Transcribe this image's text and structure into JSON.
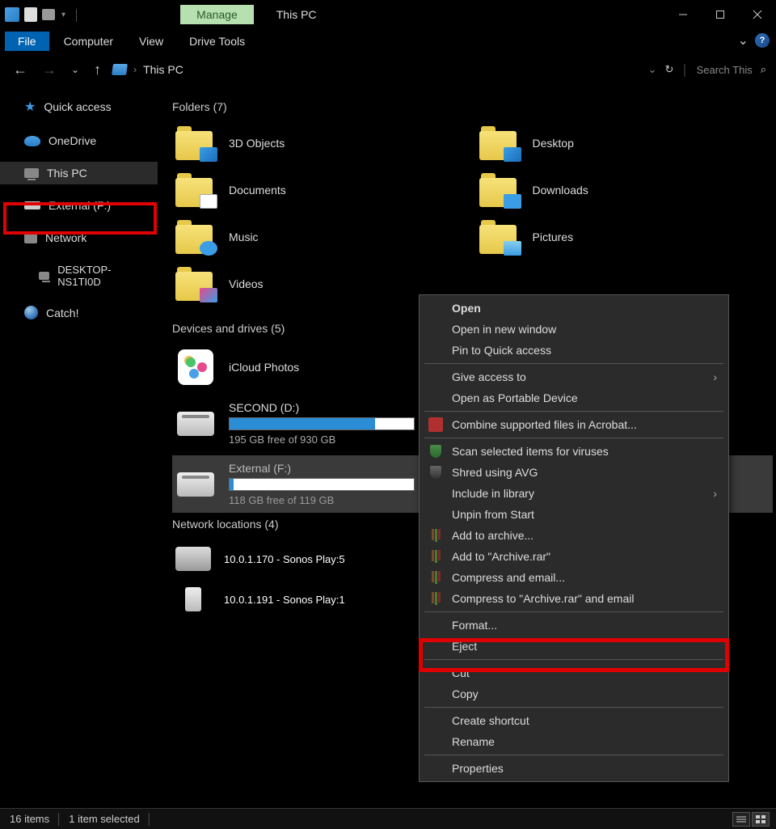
{
  "titlebar": {
    "manage_label": "Manage",
    "title": "This PC"
  },
  "ribbon": {
    "file": "File",
    "tabs": [
      "Computer",
      "View",
      "Drive Tools"
    ]
  },
  "addressbar": {
    "location": "This PC",
    "search_placeholder": "Search This"
  },
  "sidebar": {
    "quick_access": "Quick access",
    "onedrive": "OneDrive",
    "this_pc": "This PC",
    "external": "External (F:)",
    "network": "Network",
    "desktop_node": "DESKTOP-NS1TI0D",
    "catch": "Catch!"
  },
  "sections": {
    "folders_header": "Folders (7)",
    "devices_header": "Devices and drives (5)",
    "network_header": "Network locations (4)"
  },
  "folders": {
    "f0": "3D Objects",
    "f1": "Desktop",
    "f2": "Documents",
    "f3": "Downloads",
    "f4": "Music",
    "f5": "Pictures",
    "f6": "Videos"
  },
  "devices": {
    "icloud": "iCloud Photos",
    "second_name": "SECOND (D:)",
    "second_free": "195 GB free of 930 GB",
    "second_pct": 79,
    "external_name": "External (F:)",
    "external_free": "118 GB free of 119 GB",
    "external_pct": 2
  },
  "netloc": {
    "n0": "10.0.1.170 - Sonos Play:5",
    "n1": "10.0.1.191 - Sonos Play:1"
  },
  "context_menu": {
    "open": "Open",
    "open_new": "Open in new window",
    "pin_qa": "Pin to Quick access",
    "give_access": "Give access to",
    "open_portable": "Open as Portable Device",
    "combine_pdf": "Combine supported files in Acrobat...",
    "scan_virus": "Scan selected items for viruses",
    "shred": "Shred using AVG",
    "include_lib": "Include in library",
    "unpin_start": "Unpin from Start",
    "add_archive": "Add to archive...",
    "add_archive_rar": "Add to \"Archive.rar\"",
    "compress_email": "Compress and email...",
    "compress_rar_email": "Compress to \"Archive.rar\" and email",
    "format": "Format...",
    "eject": "Eject",
    "cut": "Cut",
    "copy": "Copy",
    "create_shortcut": "Create shortcut",
    "rename": "Rename",
    "properties": "Properties"
  },
  "statusbar": {
    "items": "16 items",
    "selected": "1 item selected"
  }
}
